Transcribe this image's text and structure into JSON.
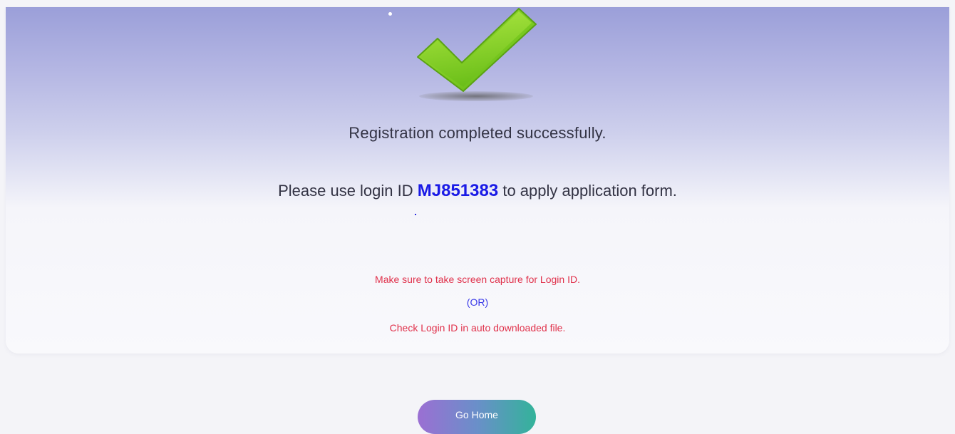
{
  "success": {
    "icon": "checkmark-icon",
    "title": "Registration completed successfully.",
    "login_prefix": "Please use login ID",
    "login_id": "MJ851383",
    "login_suffix": "to apply application form."
  },
  "notice": {
    "line1": "Make sure to take screen capture for Login ID.",
    "line2": "(OR)",
    "line3": "Check Login ID in auto downloaded file."
  },
  "actions": {
    "go_home_label": "Go Home"
  },
  "colors": {
    "login_id": "#1a1ae6",
    "notice_red": "#e0314b",
    "notice_blue": "#3a3ae8",
    "check_green": "#6cc319"
  }
}
